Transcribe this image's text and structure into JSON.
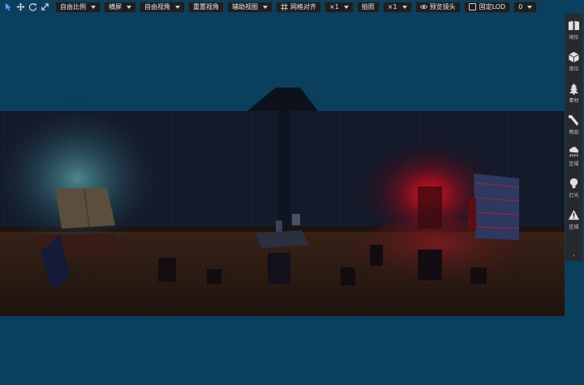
{
  "toolbar": {
    "icons": [
      "select-arrow-icon",
      "move-icon",
      "rotate-icon",
      "scale-icon"
    ],
    "aspect_label": "自由比例",
    "orientation_label": "横屏",
    "view_label": "自由视角",
    "reset_view_label": "重置视角",
    "aux_view_label": "辅助视图",
    "grid_snap_label": "网格对齐",
    "grid_multiplier": "×1",
    "capture_label": "拍照",
    "capture_multiplier": "×1",
    "preview_camera_label": "预览镜头",
    "fixed_lod_label": "固定LOD",
    "lod_value": "0"
  },
  "side_panel": {
    "items": [
      {
        "label": "地形",
        "icon": "terrain-book-icon"
      },
      {
        "label": "单位",
        "icon": "cube-icon"
      },
      {
        "label": "素材",
        "icon": "tree-icon"
      },
      {
        "label": "物品",
        "icon": "wand-icon"
      },
      {
        "label": "区域",
        "icon": "cloud-rain-icon"
      },
      {
        "label": "灯光",
        "icon": "lightbulb-icon"
      },
      {
        "label": "区域",
        "icon": "warning-icon"
      }
    ],
    "collapse": "›"
  },
  "colors": {
    "background": "#0a3f5e",
    "wall": "#151c2b",
    "floor": "#2a1a14",
    "red_light": "#e0101e",
    "cyan_light": "#6fd3d0"
  }
}
